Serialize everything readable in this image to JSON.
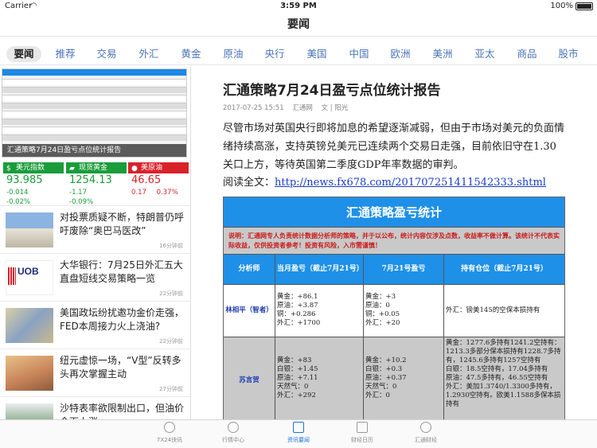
{
  "status_bar": {
    "carrier": "Carrier",
    "time": "3:59 PM",
    "battery": "100%"
  },
  "nav": {
    "title": "要闻"
  },
  "tabs": [
    "要闻",
    "推荐",
    "交易",
    "外汇",
    "黄金",
    "原油",
    "央行",
    "美国",
    "中国",
    "欧洲",
    "美洲",
    "亚太",
    "商品",
    "股市"
  ],
  "banner": {
    "caption": "汇通策略7月24日盈亏点位统计报告"
  },
  "quotes": [
    {
      "name": "美元指数",
      "value": "93.985",
      "change": "-0.014",
      "percent": "-0.02%",
      "color": "#1a9c3b",
      "icon": "dollar-icon"
    },
    {
      "name": "现货黄金",
      "value": "1254.13",
      "change": "-1.17",
      "percent": "-0.09%",
      "color": "#1a9c3b",
      "icon": "gold-bars-icon"
    },
    {
      "name": "美原油",
      "value": "46.65",
      "change": "0.17",
      "percent": "0.37%",
      "color": "#d8222a",
      "icon": "oil-drop-icon"
    }
  ],
  "news": [
    {
      "title": "对投票质疑不断，特朗普仍呼吁废除“奥巴马医改”",
      "time": "16分钟前"
    },
    {
      "title": "大华银行：7月25日外汇五大直盘短线交易策略一览",
      "time": "22分钟前"
    },
    {
      "title": "美国政坛纷扰邀功金价走强，FED本周接力火上浇油?",
      "time": "22分钟前"
    },
    {
      "title": "纽元虚惊一场，“V型”反转多头再次掌握主动",
      "time": "27分钟前"
    },
    {
      "title": "沙特表率欲限制出口，但油价全面上涨",
      "time": ""
    }
  ],
  "article": {
    "title": "汇通策略7月24日盈亏点位统计报告",
    "date": "2017-07-25 15:51",
    "source": "汇通网",
    "author": "文 | 阳光",
    "body": "尽管市场对英国央行即将加息的希望逐渐减弱，但由于市场对美元的负面情绪持续高涨，支持英镑兑美元已连续两个交易日走强，目前依旧守在1.30关口上方，等待英国第二季度GDP年率数据的审判。",
    "read_label": "阅读全文：",
    "read_link": "http://news.fx678.com/201707251411542333.shtml"
  },
  "stat_table": {
    "title": "汇通策略盈亏统计",
    "note": "说明：汇通网专人负责统计数据分析师的策略，并于以公布，统计内容仅涉及点数，收益率不做计算。该统计不代表实际收益，仅供投资者参考！投资有风险，入市需谨慎！",
    "headers": [
      "分析师",
      "当月盈亏（截止7月21号）",
      "7月21号盈亏",
      "持有仓位（截止7月21号）"
    ],
    "rows": [
      {
        "analyst": "林相平（智者）",
        "monthly": [
          "黄金：+86.1",
          "原油：+3.87",
          "铜：+0.286",
          "外汇：+1700"
        ],
        "daily": [
          "黄金：+3",
          "原油：0",
          "铜：+0.05",
          "外汇：+20"
        ],
        "position": [
          "外汇：镑美145的空保本损持有"
        ]
      },
      {
        "analyst": "苏言贺",
        "monthly": [
          "黄金：+83",
          "白银：+1.45",
          "原油：+7.11",
          "天然气：0",
          "外汇：+292"
        ],
        "daily": [
          "黄金：+10.2",
          "白银：+0.3",
          "原油：+0.37",
          "天然气：0",
          "外汇：0"
        ],
        "position": [
          "黄金：1277.6多持有1241.2空持有：1213.3多部分保本损持有1228.7多持有，1245.6多持有1257空持有",
          "白银：18.5空持有，17.04多持有",
          "原油：47.5多持有，46.55空持有",
          "外汇：美加1.3740/1.3300多持有，1.2930空持有。欧美1.1588多保本损持有"
        ]
      }
    ]
  },
  "bottom_tabs": [
    {
      "label": "7X24快讯",
      "icon": "flash-news-icon"
    },
    {
      "label": "行情中心",
      "icon": "market-chart-icon"
    },
    {
      "label": "资讯要闻",
      "icon": "news-icon"
    },
    {
      "label": "财经日历",
      "icon": "calendar-icon"
    },
    {
      "label": "汇通财经",
      "icon": "fx678-logo-icon"
    }
  ]
}
